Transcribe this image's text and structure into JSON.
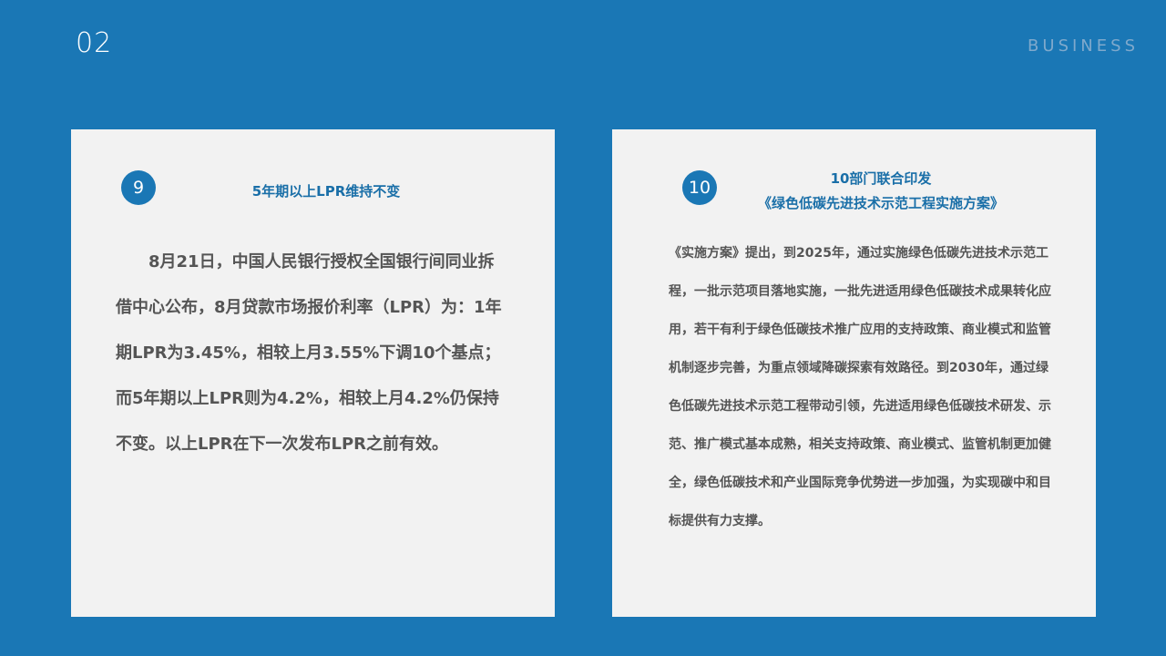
{
  "header": {
    "page_number": "02",
    "brand": "BUSINESS"
  },
  "cards": [
    {
      "badge": "9",
      "title_line1": "5年期以上LPR维持不变",
      "body": "8月21日，中国人民银行授权全国银行间同业拆借中心公布，8月贷款市场报价利率（LPR）为：1年期LPR为3.45%，相较上月3.55%下调10个基点；而5年期以上LPR则为4.2%，相较上月4.2%仍保持不变。以上LPR在下一次发布LPR之前有效。"
    },
    {
      "badge": "10",
      "title_line1": "10部门联合印发",
      "title_line2": "《绿色低碳先进技术示范工程实施方案》",
      "body": "《实施方案》提出，到2025年，通过实施绿色低碳先进技术示范工程，一批示范项目落地实施，一批先进适用绿色低碳技术成果转化应用，若干有利于绿色低碳技术推广应用的支持政策、商业模式和监管机制逐步完善，为重点领域降碳探索有效路径。到2030年，通过绿色低碳先进技术示范工程带动引领，先进适用绿色低碳技术研发、示范、推广模式基本成熟，相关支持政策、商业模式、监管机制更加健全，绿色低碳技术和产业国际竞争优势进一步加强，为实现碳中和目标提供有力支撑。"
    }
  ]
}
